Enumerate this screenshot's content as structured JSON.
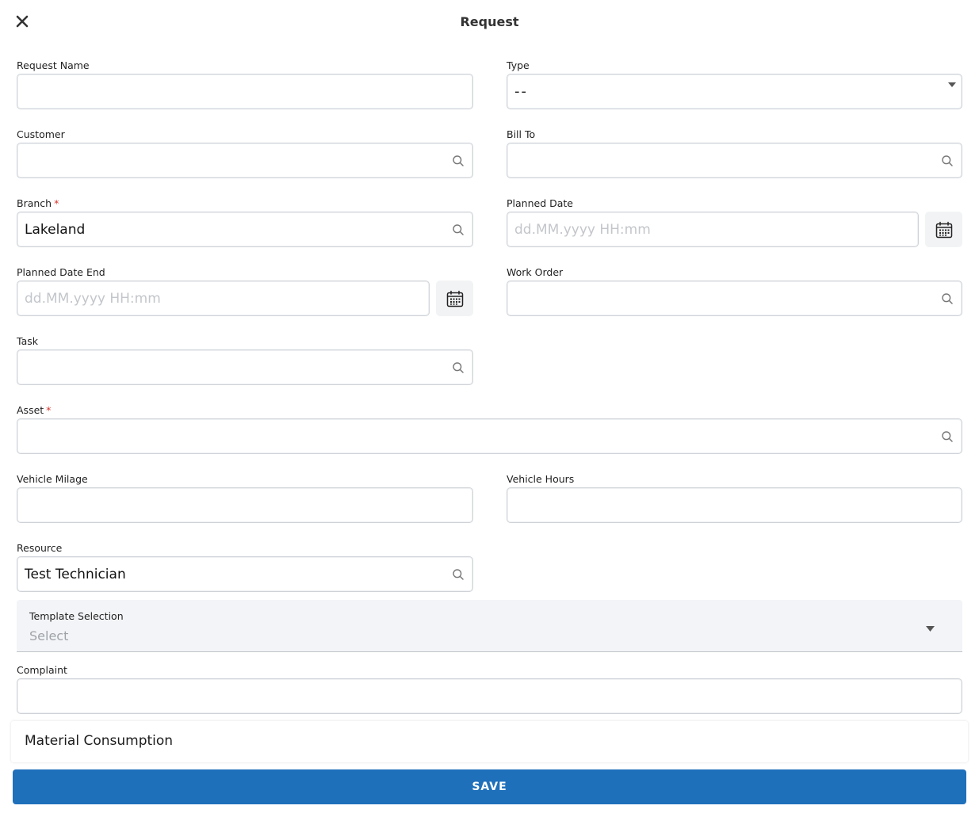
{
  "header": {
    "title": "Request"
  },
  "fields": {
    "request_name": {
      "label": "Request Name",
      "value": ""
    },
    "type": {
      "label": "Type",
      "value": "--"
    },
    "customer": {
      "label": "Customer",
      "value": ""
    },
    "bill_to": {
      "label": "Bill To",
      "value": ""
    },
    "branch": {
      "label": "Branch",
      "required_mark": "*",
      "value": "Lakeland"
    },
    "planned_date": {
      "label": "Planned Date",
      "placeholder": "dd.MM.yyyy HH:mm"
    },
    "planned_date_end": {
      "label": "Planned Date End",
      "placeholder": "dd.MM.yyyy HH:mm"
    },
    "work_order": {
      "label": "Work Order",
      "value": ""
    },
    "task": {
      "label": "Task",
      "value": ""
    },
    "asset": {
      "label": "Asset",
      "required_mark": "*",
      "value": ""
    },
    "vehicle_milage": {
      "label": "Vehicle Milage",
      "value": ""
    },
    "vehicle_hours": {
      "label": "Vehicle Hours",
      "value": ""
    },
    "resource": {
      "label": "Resource",
      "value": "Test Technician"
    },
    "template_selection": {
      "label": "Template Selection",
      "value": "Select"
    },
    "complaint": {
      "label": "Complaint",
      "value": ""
    }
  },
  "material_consumption": {
    "label": "Material Consumption"
  },
  "actions": {
    "save_label": "SAVE"
  },
  "colors": {
    "primary": "#1f70bb",
    "required": "#d9342b",
    "border": "#cfd3d8"
  }
}
